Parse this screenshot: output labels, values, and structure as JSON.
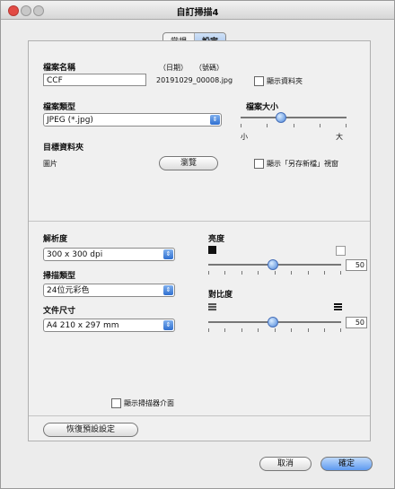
{
  "window": {
    "title": "自訂掃描4"
  },
  "tabs": [
    {
      "label": "常規"
    },
    {
      "label": "設定"
    }
  ],
  "file": {
    "name_label": "檔案名稱",
    "date_tag": "（日期）",
    "number_tag": "（號碼）",
    "name_value": "CCF",
    "generated_name": "20191029_00008.jpg",
    "show_folder_label": "顯示資料夾"
  },
  "file_type": {
    "label": "檔案類型",
    "selected": "JPEG (*.jpg)"
  },
  "file_size": {
    "label": "檔案大小",
    "small_label": "小",
    "large_label": "大",
    "level_percent": 37
  },
  "destination": {
    "label": "目標資料夾",
    "value": "圖片",
    "browse_label": "瀏覽",
    "save_as_label": "顯示「另存新檔」視窗"
  },
  "resolution": {
    "label": "解析度",
    "selected": "300 x 300 dpi"
  },
  "scan_type": {
    "label": "掃描類型",
    "selected": "24位元彩色"
  },
  "document_size": {
    "label": "文件尺寸",
    "selected": "A4 210 x 297 mm"
  },
  "brightness": {
    "label": "亮度",
    "value": "50",
    "level_percent": 48
  },
  "contrast": {
    "label": "對比度",
    "value": "50",
    "level_percent": 48
  },
  "scanner_interface_label": "顯示掃描器介面",
  "restore_defaults_label": "恢復預設設定",
  "cancel_label": "取消",
  "ok_label": "確定",
  "colors": {
    "accent": "#5e9af0",
    "selected_tab": "#9fbfea"
  }
}
